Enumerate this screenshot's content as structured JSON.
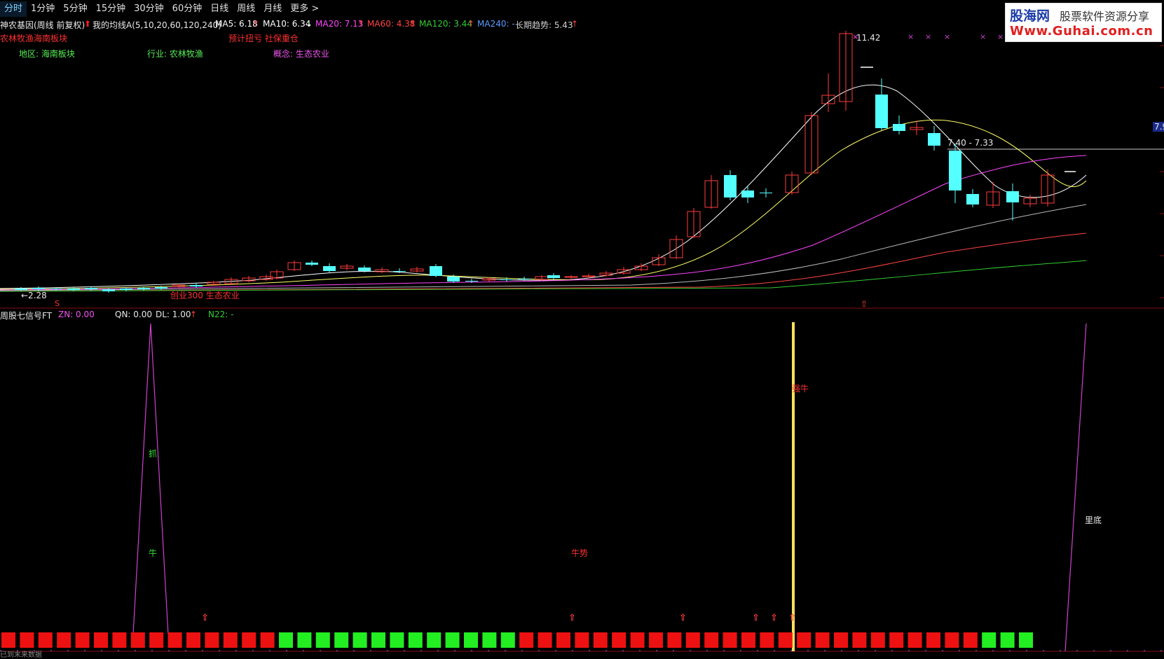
{
  "tabs": [
    {
      "label": "分时",
      "active": true
    },
    {
      "label": "1分钟"
    },
    {
      "label": "5分钟"
    },
    {
      "label": "15分钟"
    },
    {
      "label": "30分钟"
    },
    {
      "label": "60分钟"
    },
    {
      "label": "日线"
    },
    {
      "label": "周线"
    },
    {
      "label": "月线"
    },
    {
      "label": "更多 >"
    }
  ],
  "logo": {
    "line1": "股海网",
    "line1b": "股票软件资源分享",
    "line2": "Www.Guhai.com.cn"
  },
  "header": {
    "stock_title": "神农基因(周线 前复权)",
    "ma_name": "我的均线A(5,10,20,60,120,240)",
    "ma5": "MA5: 6.18",
    "ma10": "MA10: 6.34",
    "ma20": "MA20: 7.13",
    "ma60": "MA60: 4.38",
    "ma120": "MA120: 3.44",
    "ma240": "MA240: -",
    "trend": "长期趋势: 5.43",
    "sector_tag": "农林牧渔海南板块",
    "forecast_tag": "预计扭亏 社保重仓",
    "region": "地区: 海南板块",
    "industry": "行业: 农林牧渔",
    "concept": "概念: 生态农业"
  },
  "price_labels": {
    "high": "11.42",
    "low": "←2.28",
    "range": "7.40 - 7.33",
    "right_axis": "7.9",
    "bottom_tag": "创业300 生态农业",
    "s_marker": "S"
  },
  "indicator": {
    "name": "周股七信号FT",
    "zn": "ZN: 0.00",
    "qn": "QN: 0.00",
    "dl": "DL: 1.00",
    "n22": "N22: -",
    "labels": {
      "zhua": "抓",
      "niu": "牛",
      "niushi": "牛势",
      "qiangniu": "强牛",
      "lidi": "里底"
    },
    "status_text": "已到末来数据"
  },
  "colors": {
    "up": "#ff3b3b",
    "down": "#54ffff",
    "ma5": "#ffffff",
    "ma10": "#ffff66",
    "ma20": "#ff44ff",
    "ma60": "#ff4444",
    "ma120": "#33cc33",
    "magenta": "#d040d0",
    "yellow": "#ffe05a",
    "green_block": "#22ee22",
    "red_block": "#ee1111"
  },
  "block_pattern": "RRRRRRRRRRRRRRRGGGGGGGGGGGGGRRRRRRRRRRRRRRRRRRRRRRRRRGGGGGGGGGG"
}
